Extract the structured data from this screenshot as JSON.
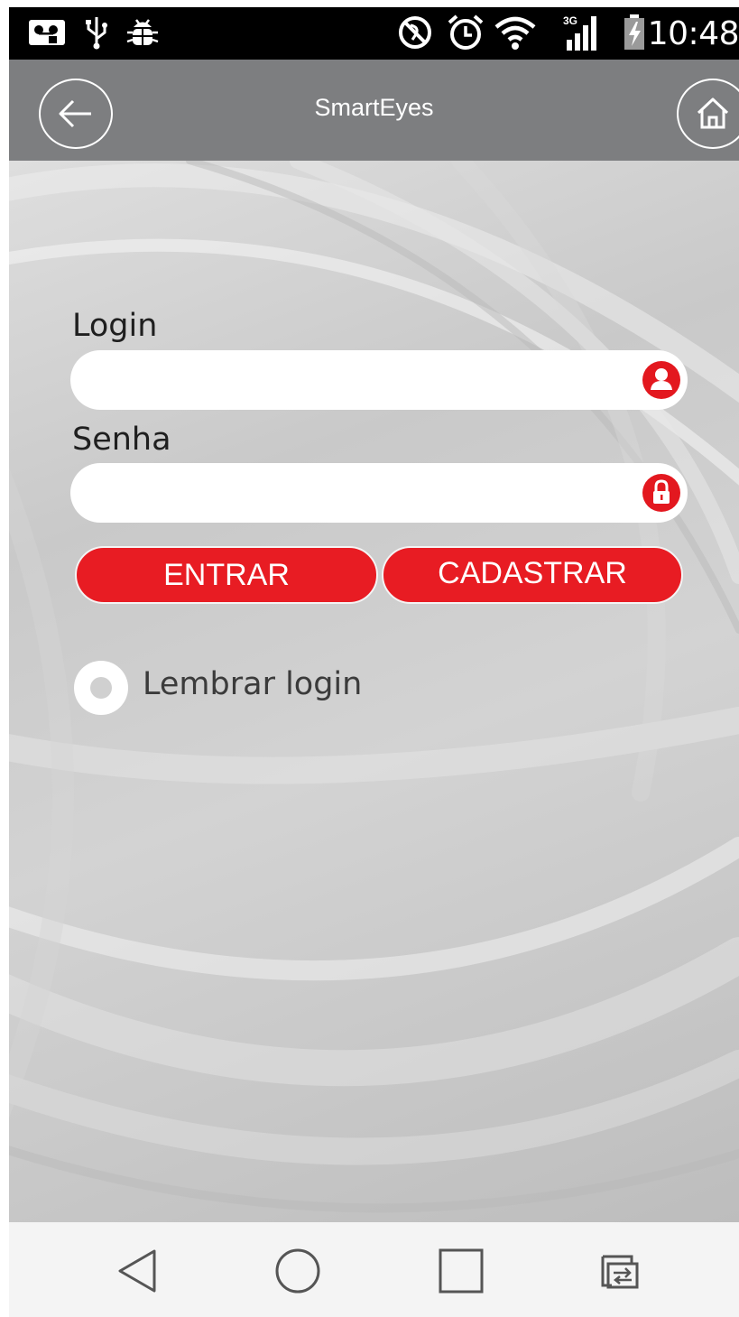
{
  "status_bar": {
    "time": "10:48",
    "network_badge": "3G",
    "left_icons": [
      "voicemail-icon",
      "usb-icon",
      "bug-icon"
    ],
    "right_icons": [
      "do-not-disturb-icon",
      "alarm-icon",
      "wifi-icon",
      "signal-icon",
      "battery-charging-icon"
    ]
  },
  "app_bar": {
    "title": "SmartEyes",
    "back_icon": "arrow-left-icon",
    "home_icon": "home-icon",
    "background_color": "#7d7e80"
  },
  "form": {
    "login_label": "Login",
    "login_value": "",
    "login_icon": "user-icon",
    "password_label": "Senha",
    "password_value": "",
    "password_icon": "lock-icon",
    "enter_button": "ENTRAR",
    "register_button": "CADASTRAR",
    "remember_label": "Lembrar login",
    "remember_checked": false,
    "accent_color": "#e81c23"
  },
  "nav_bar": {
    "buttons": [
      "back-triangle-icon",
      "home-circle-icon",
      "recents-square-icon",
      "switch-apps-icon"
    ]
  }
}
